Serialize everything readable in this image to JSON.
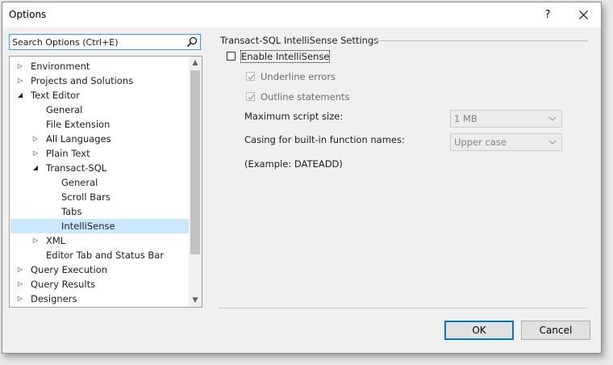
{
  "window": {
    "title": "Options",
    "help_label": "?",
    "close_icon": "close-icon"
  },
  "search": {
    "placeholder": "Search Options (Ctrl+E)",
    "value": ""
  },
  "tree": {
    "items": [
      {
        "label": "Environment",
        "state": "collapsed"
      },
      {
        "label": "Projects and Solutions",
        "state": "collapsed"
      },
      {
        "label": "Text Editor",
        "state": "expanded"
      },
      {
        "label": "General",
        "state": "leaf"
      },
      {
        "label": "File Extension",
        "state": "leaf"
      },
      {
        "label": "All Languages",
        "state": "collapsed"
      },
      {
        "label": "Plain Text",
        "state": "collapsed"
      },
      {
        "label": "Transact-SQL",
        "state": "expanded"
      },
      {
        "label": "General",
        "state": "leaf"
      },
      {
        "label": "Scroll Bars",
        "state": "leaf"
      },
      {
        "label": "Tabs",
        "state": "leaf"
      },
      {
        "label": "IntelliSense",
        "state": "leaf",
        "selected": true
      },
      {
        "label": "XML",
        "state": "collapsed"
      },
      {
        "label": "Editor Tab and Status Bar",
        "state": "leaf"
      },
      {
        "label": "Query Execution",
        "state": "collapsed"
      },
      {
        "label": "Query Results",
        "state": "collapsed"
      },
      {
        "label": "Designers",
        "state": "collapsed"
      }
    ]
  },
  "settings": {
    "group_title": "Transact-SQL IntelliSense Settings",
    "enable_intellisense": {
      "label": "Enable IntelliSense",
      "checked": false
    },
    "underline_errors": {
      "label": "Underline errors",
      "checked": true,
      "enabled": false
    },
    "outline_statements": {
      "label": "Outline statements",
      "checked": true,
      "enabled": false
    },
    "max_script_size": {
      "label": "Maximum script size:",
      "value": "1  MB"
    },
    "casing": {
      "label": "Casing for built-in function names:",
      "value": "Upper case"
    },
    "example": "(Example: DATEADD)"
  },
  "buttons": {
    "ok": "OK",
    "cancel": "Cancel"
  },
  "colors": {
    "selection": "#cce8ff",
    "accent": "#0078d7"
  }
}
